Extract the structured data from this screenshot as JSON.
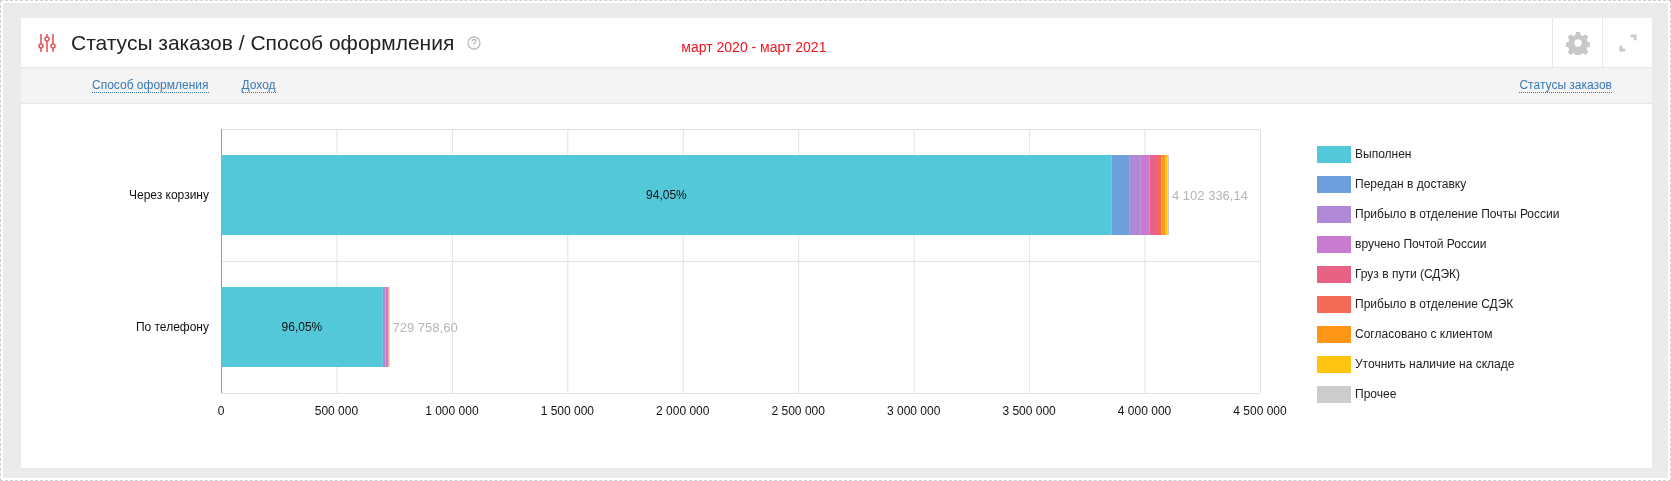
{
  "widget": {
    "title": "Статусы заказов / Способ оформления",
    "period": "март 2020 - март 2021"
  },
  "tabs": [
    {
      "label": "Способ оформления"
    },
    {
      "label": "Доход"
    }
  ],
  "group_link": "Статусы заказов",
  "chart_data": {
    "type": "bar",
    "orientation": "horizontal",
    "stacked": true,
    "categories": [
      "Через корзину",
      "По телефону"
    ],
    "series": [
      {
        "name": "Выполнен",
        "color": "#52c8d8",
        "values": [
          3858000,
          701000
        ]
      },
      {
        "name": "Передан в доставку",
        "color": "#6d9fdc",
        "values": [
          78000,
          0
        ]
      },
      {
        "name": "Прибыло в отделение Почты России",
        "color": "#b08ad6",
        "values": [
          48000,
          12000
        ]
      },
      {
        "name": "вручено Почтой России",
        "color": "#c97ccf",
        "values": [
          38000,
          13000
        ]
      },
      {
        "name": "Груз в пути (СДЭК)",
        "color": "#e86285",
        "values": [
          32000,
          0
        ]
      },
      {
        "name": "Прибыло в отделение СДЭК",
        "color": "#f36b56",
        "values": [
          20000,
          0
        ]
      },
      {
        "name": "Согласовано с клиентом",
        "color": "#ff9615",
        "values": [
          15000,
          0
        ]
      },
      {
        "name": "Уточнить наличие на складе",
        "color": "#ffc410",
        "values": [
          9000,
          4000
        ]
      },
      {
        "name": "Прочее",
        "color": "#cccccc",
        "values": [
          8000,
          0
        ]
      }
    ],
    "grid": true,
    "xlim": [
      0,
      4500000
    ],
    "xticks": [
      {
        "value": 0,
        "label": "0"
      },
      {
        "value": 500000,
        "label": "500 000"
      },
      {
        "value": 1000000,
        "label": "1 000 000"
      },
      {
        "value": 1500000,
        "label": "1 500 000"
      },
      {
        "value": 2000000,
        "label": "2 000 000"
      },
      {
        "value": 2500000,
        "label": "2 500 000"
      },
      {
        "value": 3000000,
        "label": "3 000 000"
      },
      {
        "value": 3500000,
        "label": "3 500 000"
      },
      {
        "value": 4000000,
        "label": "4 000 000"
      },
      {
        "value": 4500000,
        "label": "4 500 000"
      }
    ],
    "value_labels": [
      "4 102 336,14",
      "729 758,60"
    ],
    "annotations": [
      "94,05%",
      "96,05%"
    ]
  }
}
